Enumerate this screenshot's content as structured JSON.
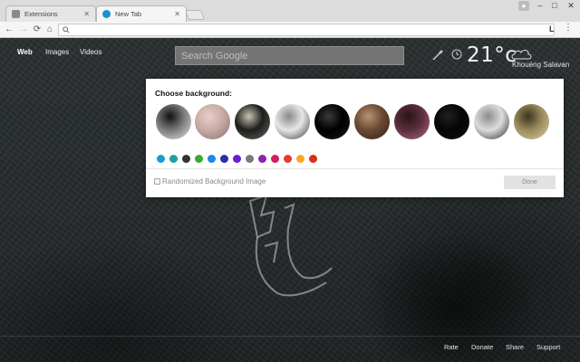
{
  "browser": {
    "tabs": [
      {
        "title": "Extensions",
        "icon": "puzzle-icon"
      },
      {
        "title": "New Tab",
        "icon": "newtab-favicon"
      }
    ],
    "window_controls": [
      "minimize",
      "maximize",
      "close"
    ],
    "extension_badge": "L",
    "menu_icon": "kebab-menu-icon"
  },
  "search": {
    "nav": [
      "Web",
      "Images",
      "Videos"
    ],
    "active_nav": "Web",
    "placeholder": "Search Google"
  },
  "weather": {
    "temperature": "21°c",
    "location": "Khouéng Salavan",
    "condition_icon": "cloud-icon"
  },
  "dialog": {
    "title": "Choose background:",
    "thumbnails": [
      {
        "name": "bg-thumb-1",
        "colors": [
          "#7a7a7a",
          "#e8e8e8",
          "#111111"
        ]
      },
      {
        "name": "bg-thumb-2",
        "colors": [
          "#c8aaa6",
          "#8a6e6a",
          "#e7cfc9"
        ]
      },
      {
        "name": "bg-thumb-3",
        "colors": [
          "#1d1d1d",
          "#6b6b5f",
          "#c9c2b0"
        ]
      },
      {
        "name": "bg-thumb-4",
        "colors": [
          "#e6e6e6",
          "#3a3a3a",
          "#8a8a8a"
        ]
      },
      {
        "name": "bg-thumb-5",
        "colors": [
          "#000000",
          "#1a1a1a",
          "#3a3a3a"
        ]
      },
      {
        "name": "bg-thumb-6",
        "colors": [
          "#6b4a33",
          "#2b2019",
          "#b89373"
        ]
      },
      {
        "name": "bg-thumb-7",
        "colors": [
          "#5a2e3c",
          "#b46a7a",
          "#2a1418"
        ]
      },
      {
        "name": "bg-thumb-8",
        "colors": [
          "#050505",
          "#111111",
          "#202020"
        ]
      },
      {
        "name": "bg-thumb-9",
        "colors": [
          "#dcdcdc",
          "#2a2a2a",
          "#8c8c8c"
        ]
      },
      {
        "name": "bg-thumb-10",
        "colors": [
          "#9a8b5a",
          "#d9d0a8",
          "#3a3420"
        ]
      }
    ],
    "swatches": [
      "#1a9bd6",
      "#1aa3a3",
      "#333333",
      "#3aaa35",
      "#1e88e5",
      "#2e2ea8",
      "#6a1bd6",
      "#7a7a7a",
      "#8e24aa",
      "#d81b60",
      "#e53935",
      "#f9a825",
      "#d62f1b"
    ],
    "randomize_label": "Randomized Background Image",
    "randomize_checked": false,
    "done_label": "Done"
  },
  "footer": {
    "links": [
      "Rate",
      "Donate",
      "Share",
      "Support"
    ]
  }
}
